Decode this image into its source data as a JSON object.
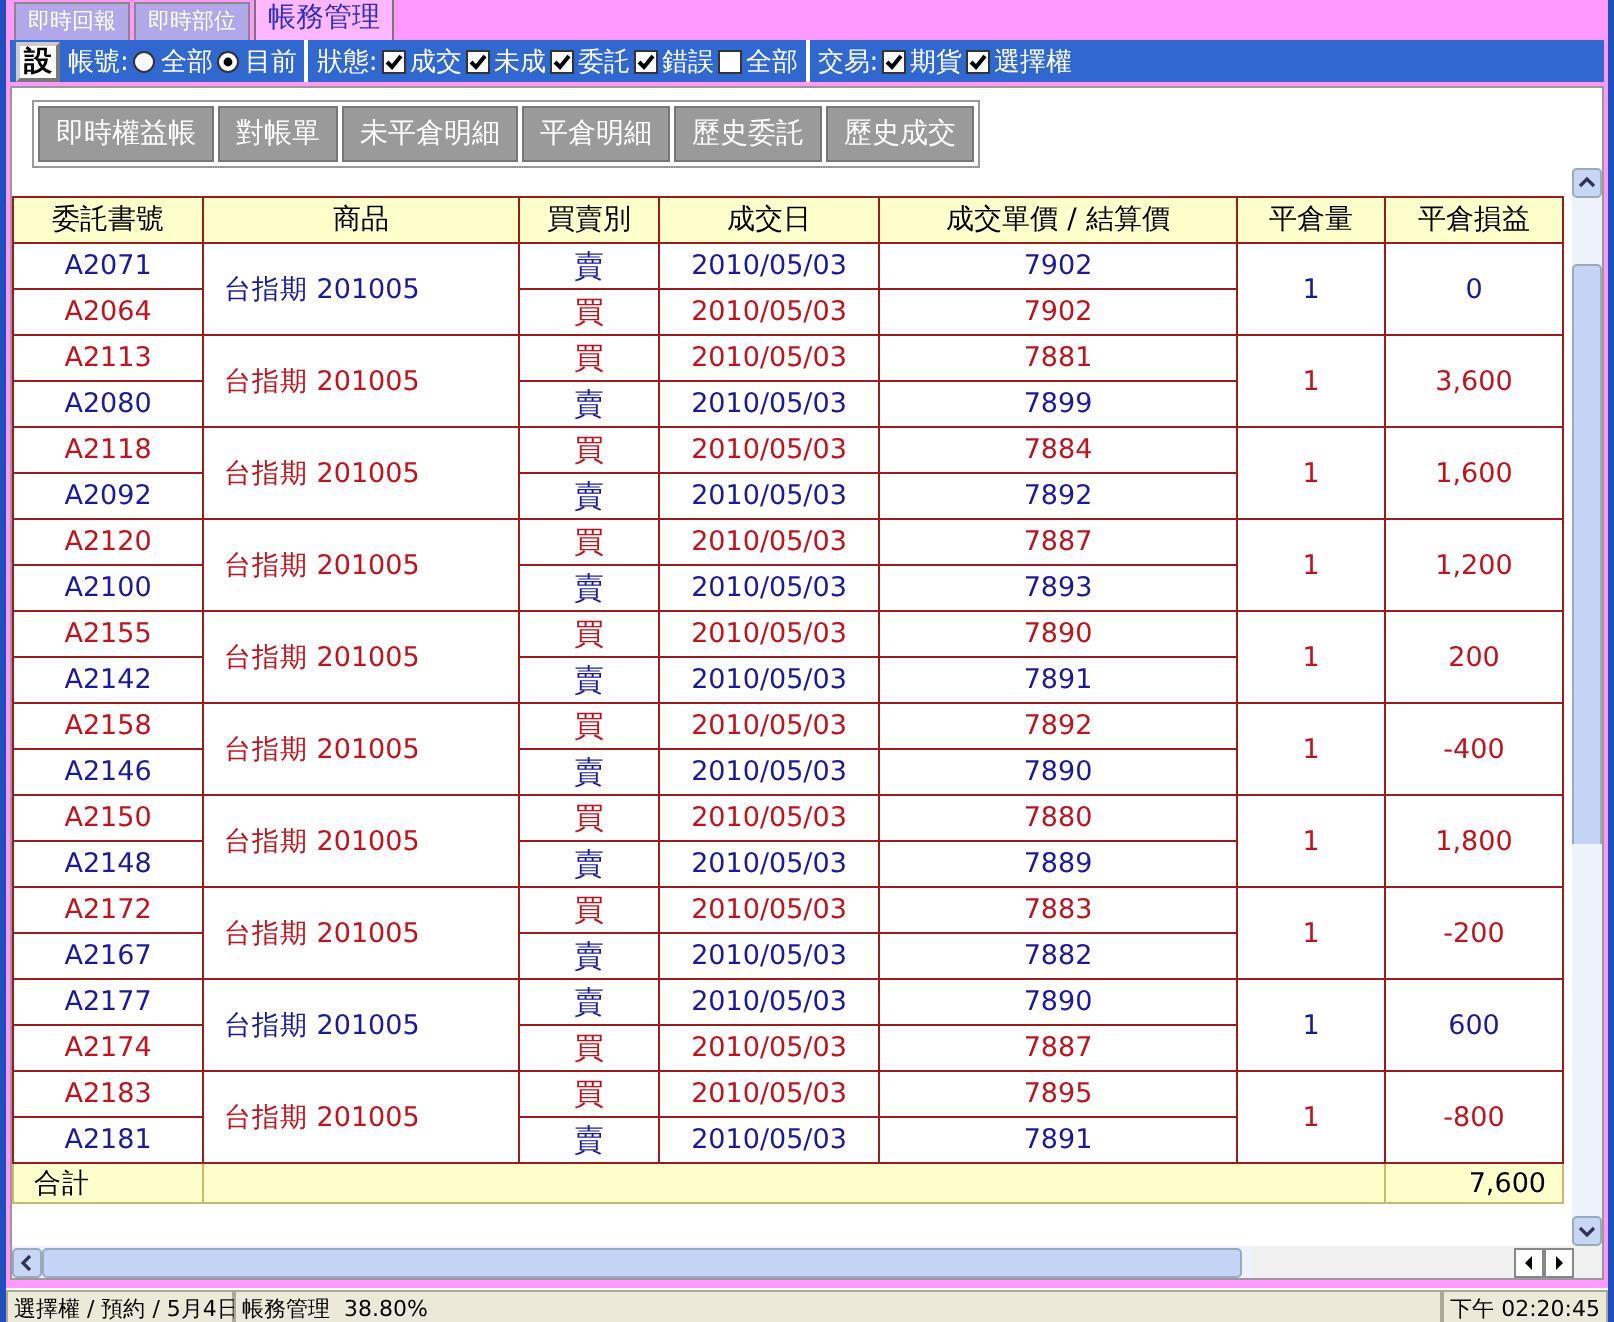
{
  "tabs": [
    {
      "label": "即時回報",
      "selected": false
    },
    {
      "label": "即時部位",
      "selected": false
    },
    {
      "label": "帳務管理",
      "selected": true
    }
  ],
  "toolbar": {
    "settings_button": "設",
    "groups": [
      {
        "label": "帳號:",
        "options": [
          {
            "kind": "radio",
            "label": "全部",
            "selected": false
          },
          {
            "kind": "radio",
            "label": "目前",
            "selected": true
          }
        ]
      },
      {
        "label": "狀態:",
        "options": [
          {
            "kind": "checkbox",
            "label": "成交",
            "checked": true
          },
          {
            "kind": "checkbox",
            "label": "未成",
            "checked": true
          },
          {
            "kind": "checkbox",
            "label": "委託",
            "checked": true
          },
          {
            "kind": "checkbox",
            "label": "錯誤",
            "checked": true
          },
          {
            "kind": "checkbox",
            "label": "全部",
            "checked": false
          }
        ]
      },
      {
        "label": "交易:",
        "options": [
          {
            "kind": "checkbox",
            "label": "期貨",
            "checked": true
          },
          {
            "kind": "checkbox",
            "label": "選擇權",
            "checked": true
          }
        ]
      }
    ]
  },
  "report_buttons": [
    "即時權益帳",
    "對帳單",
    "未平倉明細",
    "平倉明細",
    "歷史委託",
    "歷史成交"
  ],
  "table": {
    "columns": [
      "委託書號",
      "商品",
      "買賣別",
      "成交日",
      "成交單價 / 結算價",
      "平倉量",
      "平倉損益"
    ],
    "rows": [
      {
        "product": "台指期 201005",
        "quantity": "1",
        "pnl": "0",
        "legs": [
          {
            "order": "A2071",
            "kind": "sell",
            "side": "賣",
            "date": "2010/05/03",
            "price": "7902"
          },
          {
            "order": "A2064",
            "kind": "buy",
            "side": "買",
            "date": "2010/05/03",
            "price": "7902"
          }
        ]
      },
      {
        "product": "台指期 201005",
        "quantity": "1",
        "pnl": "3,600",
        "legs": [
          {
            "order": "A2113",
            "kind": "buy",
            "side": "買",
            "date": "2010/05/03",
            "price": "7881"
          },
          {
            "order": "A2080",
            "kind": "sell",
            "side": "賣",
            "date": "2010/05/03",
            "price": "7899"
          }
        ]
      },
      {
        "product": "台指期 201005",
        "quantity": "1",
        "pnl": "1,600",
        "legs": [
          {
            "order": "A2118",
            "kind": "buy",
            "side": "買",
            "date": "2010/05/03",
            "price": "7884"
          },
          {
            "order": "A2092",
            "kind": "sell",
            "side": "賣",
            "date": "2010/05/03",
            "price": "7892"
          }
        ]
      },
      {
        "product": "台指期 201005",
        "quantity": "1",
        "pnl": "1,200",
        "legs": [
          {
            "order": "A2120",
            "kind": "buy",
            "side": "買",
            "date": "2010/05/03",
            "price": "7887"
          },
          {
            "order": "A2100",
            "kind": "sell",
            "side": "賣",
            "date": "2010/05/03",
            "price": "7893"
          }
        ]
      },
      {
        "product": "台指期 201005",
        "quantity": "1",
        "pnl": "200",
        "legs": [
          {
            "order": "A2155",
            "kind": "buy",
            "side": "買",
            "date": "2010/05/03",
            "price": "7890"
          },
          {
            "order": "A2142",
            "kind": "sell",
            "side": "賣",
            "date": "2010/05/03",
            "price": "7891"
          }
        ]
      },
      {
        "product": "台指期 201005",
        "quantity": "1",
        "pnl": "-400",
        "legs": [
          {
            "order": "A2158",
            "kind": "buy",
            "side": "買",
            "date": "2010/05/03",
            "price": "7892"
          },
          {
            "order": "A2146",
            "kind": "sell",
            "side": "賣",
            "date": "2010/05/03",
            "price": "7890"
          }
        ]
      },
      {
        "product": "台指期 201005",
        "quantity": "1",
        "pnl": "1,800",
        "legs": [
          {
            "order": "A2150",
            "kind": "buy",
            "side": "買",
            "date": "2010/05/03",
            "price": "7880"
          },
          {
            "order": "A2148",
            "kind": "sell",
            "side": "賣",
            "date": "2010/05/03",
            "price": "7889"
          }
        ]
      },
      {
        "product": "台指期 201005",
        "quantity": "1",
        "pnl": "-200",
        "legs": [
          {
            "order": "A2172",
            "kind": "buy",
            "side": "買",
            "date": "2010/05/03",
            "price": "7883"
          },
          {
            "order": "A2167",
            "kind": "sell",
            "side": "賣",
            "date": "2010/05/03",
            "price": "7882"
          }
        ]
      },
      {
        "product": "台指期 201005",
        "quantity": "1",
        "pnl": "600",
        "legs": [
          {
            "order": "A2177",
            "kind": "sell",
            "side": "賣",
            "date": "2010/05/03",
            "price": "7890"
          },
          {
            "order": "A2174",
            "kind": "buy",
            "side": "買",
            "date": "2010/05/03",
            "price": "7887"
          }
        ]
      },
      {
        "product": "台指期 201005",
        "quantity": "1",
        "pnl": "-800",
        "legs": [
          {
            "order": "A2183",
            "kind": "buy",
            "side": "買",
            "date": "2010/05/03",
            "price": "7895"
          },
          {
            "order": "A2181",
            "kind": "sell",
            "side": "賣",
            "date": "2010/05/03",
            "price": "7891"
          }
        ]
      }
    ],
    "total": {
      "label": "合計",
      "pnl": "7,600"
    }
  },
  "status_bar": [
    "選擇權 / 預約 / 5月4日",
    "帳務管理  38.80%",
    "下午 02:20:45"
  ]
}
